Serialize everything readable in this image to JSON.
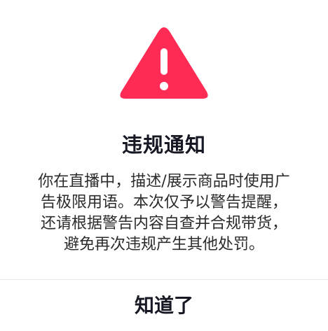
{
  "dialog": {
    "icon": "warning-triangle-icon",
    "accent_color": "#FE2C55",
    "title": "违规通知",
    "message_lines": [
      "你在直播中，描述/展示商品时使用广",
      "告极限用语。本次仅予以警告提醒，",
      "还请根据警告内容自查并合规带货，",
      "避免再次违规产生其他处罚。"
    ],
    "confirm_label": "知道了"
  }
}
